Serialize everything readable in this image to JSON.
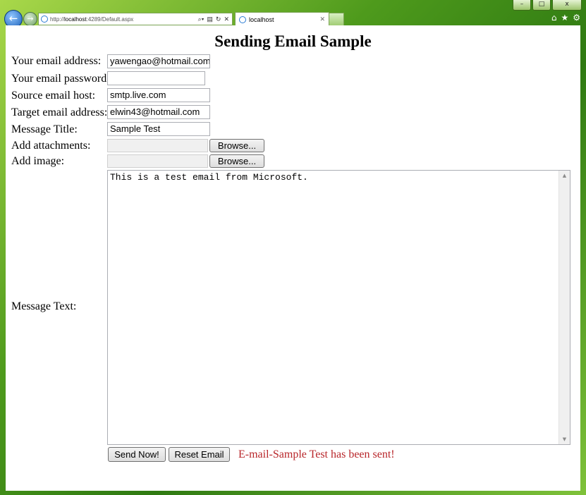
{
  "browser": {
    "address_prefix": "http://",
    "address_host": "localhost",
    "address_rest": ":4289/Default.aspx",
    "tab_title": "localhost",
    "window_buttons": [
      "–",
      "□",
      "x"
    ]
  },
  "form": {
    "heading": "Sending Email Sample",
    "labels": {
      "email": "Your email address:",
      "password": "Your email password:",
      "host": "Source email host:",
      "target": "Target email address:",
      "title": "Message Title:",
      "attachments": "Add attachments:",
      "image": "Add image:",
      "message": "Message Text:"
    },
    "values": {
      "email": "yawengao@hotmail.com",
      "password": "",
      "host": "smtp.live.com",
      "target": "elwin43@hotmail.com",
      "title": "Sample Test",
      "message": "This is a test email from Microsoft."
    },
    "browse_label": "Browse...",
    "send_label": "Send Now!",
    "reset_label": "Reset Email",
    "status": "E-mail-Sample Test has been sent!"
  },
  "colors": {
    "status": "#b8262a",
    "chrome": "#4e9a1c"
  }
}
